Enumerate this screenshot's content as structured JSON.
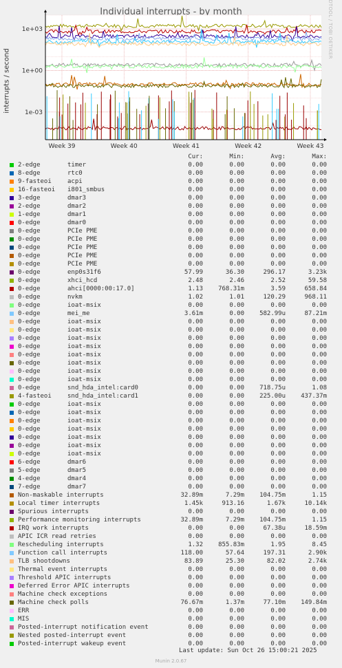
{
  "title": "Individual interrupts - by month",
  "side_text": "RRDTOOL / TOBI OETIKER",
  "version": "Munin 2.0.67",
  "last_update": "Last update: Sun Oct 26 15:00:21 2025",
  "headers": [
    "Cur:",
    "Min:",
    "Avg:",
    "Max:"
  ],
  "chart_data": {
    "type": "line",
    "ylabel": "interrupts / second",
    "yscale": "log",
    "ylim": [
      1e-05,
      10000
    ],
    "yticks": [
      {
        "label": "1e+03",
        "value": 1000
      },
      {
        "label": "1e+00",
        "value": 1
      },
      {
        "label": "1e-03",
        "value": 0.001
      }
    ],
    "xticks": [
      "Week 39",
      "Week 40",
      "Week 41",
      "Week 42",
      "Week 43"
    ],
    "grid": true,
    "series_levels": [
      {
        "name": "Local timer interrupts",
        "color": "#999900",
        "level": 1670
      },
      {
        "name": "ahci[0000:00:17.0]",
        "color": "#bb0000",
        "level": 658.84
      },
      {
        "name": "enp0s31f6",
        "color": "#330099",
        "level": 296.17
      },
      {
        "name": "Function call interrupts",
        "color": "#88aaee",
        "level": 197.31
      },
      {
        "name": "nvkm",
        "color": "#33ccff",
        "level": 120.29
      },
      {
        "name": "TLB shootdowns",
        "color": "#ffcc88",
        "level": 82.02
      },
      {
        "name": "xhci_hcd",
        "color": "#999999",
        "level": 2.52
      },
      {
        "name": "Rescheduling interrupts",
        "color": "#99ff99",
        "level": 1.95
      },
      {
        "name": "Non-maskable interrupts",
        "color": "#cc6600",
        "level": 0.1
      },
      {
        "name": "Machine check polls",
        "color": "#666600",
        "level": 0.077
      },
      {
        "name": "IRQ work interrupts",
        "color": "#990000",
        "level": 6.7e-05
      }
    ]
  },
  "legend": [
    {
      "label": "2-edge",
      "device": "timer",
      "color": "#00cc00",
      "cur": "0.00",
      "min": "0.00",
      "avg": "0.00",
      "max": "0.00"
    },
    {
      "label": "8-edge",
      "device": "rtc0",
      "color": "#0066b3",
      "cur": "0.00",
      "min": "0.00",
      "avg": "0.00",
      "max": "0.00"
    },
    {
      "label": "9-fasteoi",
      "device": "acpi",
      "color": "#ff8000",
      "cur": "0.00",
      "min": "0.00",
      "avg": "0.00",
      "max": "0.00"
    },
    {
      "label": "16-fasteoi",
      "device": "i801_smbus",
      "color": "#ffcc00",
      "cur": "0.00",
      "min": "0.00",
      "avg": "0.00",
      "max": "0.00"
    },
    {
      "label": "3-edge",
      "device": "dmar3",
      "color": "#330099",
      "cur": "0.00",
      "min": "0.00",
      "avg": "0.00",
      "max": "0.00"
    },
    {
      "label": "2-edge",
      "device": "dmar2",
      "color": "#990099",
      "cur": "0.00",
      "min": "0.00",
      "avg": "0.00",
      "max": "0.00"
    },
    {
      "label": "1-edge",
      "device": "dmar1",
      "color": "#ccff00",
      "cur": "0.00",
      "min": "0.00",
      "avg": "0.00",
      "max": "0.00"
    },
    {
      "label": "0-edge",
      "device": "dmar0",
      "color": "#ff0000",
      "cur": "0.00",
      "min": "0.00",
      "avg": "0.00",
      "max": "0.00"
    },
    {
      "label": "0-edge",
      "device": "PCIe PME",
      "color": "#808080",
      "cur": "0.00",
      "min": "0.00",
      "avg": "0.00",
      "max": "0.00"
    },
    {
      "label": "0-edge",
      "device": "PCIe PME",
      "color": "#008f00",
      "cur": "0.00",
      "min": "0.00",
      "avg": "0.00",
      "max": "0.00"
    },
    {
      "label": "0-edge",
      "device": "PCIe PME",
      "color": "#00487d",
      "cur": "0.00",
      "min": "0.00",
      "avg": "0.00",
      "max": "0.00"
    },
    {
      "label": "0-edge",
      "device": "PCIe PME",
      "color": "#b35a00",
      "cur": "0.00",
      "min": "0.00",
      "avg": "0.00",
      "max": "0.00"
    },
    {
      "label": "0-edge",
      "device": "PCIe PME",
      "color": "#b38f00",
      "cur": "0.00",
      "min": "0.00",
      "avg": "0.00",
      "max": "0.00"
    },
    {
      "label": "0-edge",
      "device": "enp0s31f6",
      "color": "#6b006b",
      "cur": "57.99",
      "min": "36.30",
      "avg": "296.17",
      "max": "3.23k"
    },
    {
      "label": "0-edge",
      "device": "xhci_hcd",
      "color": "#8fb300",
      "cur": "2.48",
      "min": "2.46",
      "avg": "2.52",
      "max": "59.58"
    },
    {
      "label": "0-edge",
      "device": "ahci[0000:00:17.0]",
      "color": "#b30000",
      "cur": "1.13",
      "min": "768.31m",
      "avg": "3.59",
      "max": "658.84"
    },
    {
      "label": "0-edge",
      "device": "nvkm",
      "color": "#bebebe",
      "cur": "1.02",
      "min": "1.01",
      "avg": "120.29",
      "max": "968.11"
    },
    {
      "label": "0-edge",
      "device": "ioat-msix",
      "color": "#80ff80",
      "cur": "0.00",
      "min": "0.00",
      "avg": "0.00",
      "max": "0.00"
    },
    {
      "label": "0-edge",
      "device": "mei_me",
      "color": "#80c9ff",
      "cur": "3.61m",
      "min": "0.00",
      "avg": "582.99u",
      "max": "87.21m"
    },
    {
      "label": "0-edge",
      "device": "ioat-msix",
      "color": "#ffc080",
      "cur": "0.00",
      "min": "0.00",
      "avg": "0.00",
      "max": "0.00"
    },
    {
      "label": "0-edge",
      "device": "ioat-msix",
      "color": "#ffe680",
      "cur": "0.00",
      "min": "0.00",
      "avg": "0.00",
      "max": "0.00"
    },
    {
      "label": "0-edge",
      "device": "ioat-msix",
      "color": "#aa80ff",
      "cur": "0.00",
      "min": "0.00",
      "avg": "0.00",
      "max": "0.00"
    },
    {
      "label": "0-edge",
      "device": "ioat-msix",
      "color": "#ee00cc",
      "cur": "0.00",
      "min": "0.00",
      "avg": "0.00",
      "max": "0.00"
    },
    {
      "label": "0-edge",
      "device": "ioat-msix",
      "color": "#ff8080",
      "cur": "0.00",
      "min": "0.00",
      "avg": "0.00",
      "max": "0.00"
    },
    {
      "label": "0-edge",
      "device": "ioat-msix",
      "color": "#666600",
      "cur": "0.00",
      "min": "0.00",
      "avg": "0.00",
      "max": "0.00"
    },
    {
      "label": "0-edge",
      "device": "ioat-msix",
      "color": "#ffbfff",
      "cur": "0.00",
      "min": "0.00",
      "avg": "0.00",
      "max": "0.00"
    },
    {
      "label": "0-edge",
      "device": "ioat-msix",
      "color": "#00ffcc",
      "cur": "0.00",
      "min": "0.00",
      "avg": "0.00",
      "max": "0.00"
    },
    {
      "label": "0-edge",
      "device": "snd_hda_intel:card0",
      "color": "#cc6699",
      "cur": "0.00",
      "min": "0.00",
      "avg": "718.75u",
      "max": "1.08"
    },
    {
      "label": "4-fasteoi",
      "device": "snd_hda_intel:card1",
      "color": "#999900",
      "cur": "0.00",
      "min": "0.00",
      "avg": "225.00u",
      "max": "437.37m"
    },
    {
      "label": "0-edge",
      "device": "ioat-msix",
      "color": "#00cc00",
      "cur": "0.00",
      "min": "0.00",
      "avg": "0.00",
      "max": "0.00"
    },
    {
      "label": "0-edge",
      "device": "ioat-msix",
      "color": "#0066b3",
      "cur": "0.00",
      "min": "0.00",
      "avg": "0.00",
      "max": "0.00"
    },
    {
      "label": "0-edge",
      "device": "ioat-msix",
      "color": "#ff8000",
      "cur": "0.00",
      "min": "0.00",
      "avg": "0.00",
      "max": "0.00"
    },
    {
      "label": "0-edge",
      "device": "ioat-msix",
      "color": "#ffcc00",
      "cur": "0.00",
      "min": "0.00",
      "avg": "0.00",
      "max": "0.00"
    },
    {
      "label": "0-edge",
      "device": "ioat-msix",
      "color": "#330099",
      "cur": "0.00",
      "min": "0.00",
      "avg": "0.00",
      "max": "0.00"
    },
    {
      "label": "0-edge",
      "device": "ioat-msix",
      "color": "#990099",
      "cur": "0.00",
      "min": "0.00",
      "avg": "0.00",
      "max": "0.00"
    },
    {
      "label": "0-edge",
      "device": "ioat-msix",
      "color": "#ccff00",
      "cur": "0.00",
      "min": "0.00",
      "avg": "0.00",
      "max": "0.00"
    },
    {
      "label": "6-edge",
      "device": "dmar6",
      "color": "#ff0000",
      "cur": "0.00",
      "min": "0.00",
      "avg": "0.00",
      "max": "0.00"
    },
    {
      "label": "5-edge",
      "device": "dmar5",
      "color": "#808080",
      "cur": "0.00",
      "min": "0.00",
      "avg": "0.00",
      "max": "0.00"
    },
    {
      "label": "4-edge",
      "device": "dmar4",
      "color": "#008f00",
      "cur": "0.00",
      "min": "0.00",
      "avg": "0.00",
      "max": "0.00"
    },
    {
      "label": "7-edge",
      "device": "dmar7",
      "color": "#00487d",
      "cur": "0.00",
      "min": "0.00",
      "avg": "0.00",
      "max": "0.00"
    },
    {
      "label": "Non-maskable interrupts",
      "device": "",
      "color": "#b35a00",
      "cur": "32.89m",
      "min": "7.29m",
      "avg": "104.75m",
      "max": "1.15"
    },
    {
      "label": "Local timer interrupts",
      "device": "",
      "color": "#b38f00",
      "cur": "1.45k",
      "min": "913.16",
      "avg": "1.67k",
      "max": "10.14k"
    },
    {
      "label": "Spurious interrupts",
      "device": "",
      "color": "#6b006b",
      "cur": "0.00",
      "min": "0.00",
      "avg": "0.00",
      "max": "0.00"
    },
    {
      "label": "Performance monitoring interrupts",
      "device": "",
      "color": "#8fb300",
      "cur": "32.89m",
      "min": "7.29m",
      "avg": "104.75m",
      "max": "1.15"
    },
    {
      "label": "IRQ work interrupts",
      "device": "",
      "color": "#b30000",
      "cur": "0.00",
      "min": "0.00",
      "avg": "67.38u",
      "max": "18.59m"
    },
    {
      "label": "APIC ICR read retries",
      "device": "",
      "color": "#bebebe",
      "cur": "0.00",
      "min": "0.00",
      "avg": "0.00",
      "max": "0.00"
    },
    {
      "label": "Rescheduling interrupts",
      "device": "",
      "color": "#80ff80",
      "cur": "1.32",
      "min": "855.83m",
      "avg": "1.95",
      "max": "8.45"
    },
    {
      "label": "Function call interrupts",
      "device": "",
      "color": "#80c9ff",
      "cur": "118.00",
      "min": "57.64",
      "avg": "197.31",
      "max": "2.90k"
    },
    {
      "label": "TLB shootdowns",
      "device": "",
      "color": "#ffc080",
      "cur": "83.89",
      "min": "25.30",
      "avg": "82.02",
      "max": "2.74k"
    },
    {
      "label": "Thermal event interrupts",
      "device": "",
      "color": "#ffe680",
      "cur": "0.00",
      "min": "0.00",
      "avg": "0.00",
      "max": "0.00"
    },
    {
      "label": "Threshold APIC interrupts",
      "device": "",
      "color": "#aa80ff",
      "cur": "0.00",
      "min": "0.00",
      "avg": "0.00",
      "max": "0.00"
    },
    {
      "label": "Deferred Error APIC interrupts",
      "device": "",
      "color": "#ee00cc",
      "cur": "0.00",
      "min": "0.00",
      "avg": "0.00",
      "max": "0.00"
    },
    {
      "label": "Machine check exceptions",
      "device": "",
      "color": "#ff8080",
      "cur": "0.00",
      "min": "0.00",
      "avg": "0.00",
      "max": "0.00"
    },
    {
      "label": "Machine check polls",
      "device": "",
      "color": "#666600",
      "cur": "76.67m",
      "min": "1.37m",
      "avg": "77.10m",
      "max": "149.84m"
    },
    {
      "label": "ERR",
      "device": "",
      "color": "#ffbfff",
      "cur": "0.00",
      "min": "0.00",
      "avg": "0.00",
      "max": "0.00"
    },
    {
      "label": "MIS",
      "device": "",
      "color": "#00ffcc",
      "cur": "0.00",
      "min": "0.00",
      "avg": "0.00",
      "max": "0.00"
    },
    {
      "label": "Posted-interrupt notification event",
      "device": "",
      "color": "#cc6699",
      "cur": "0.00",
      "min": "0.00",
      "avg": "0.00",
      "max": "0.00"
    },
    {
      "label": "Nested posted-interrupt event",
      "device": "",
      "color": "#999900",
      "cur": "0.00",
      "min": "0.00",
      "avg": "0.00",
      "max": "0.00"
    },
    {
      "label": "Posted-interrupt wakeup event",
      "device": "",
      "color": "#00cc00",
      "cur": "0.00",
      "min": "0.00",
      "avg": "0.00",
      "max": "0.00"
    }
  ]
}
